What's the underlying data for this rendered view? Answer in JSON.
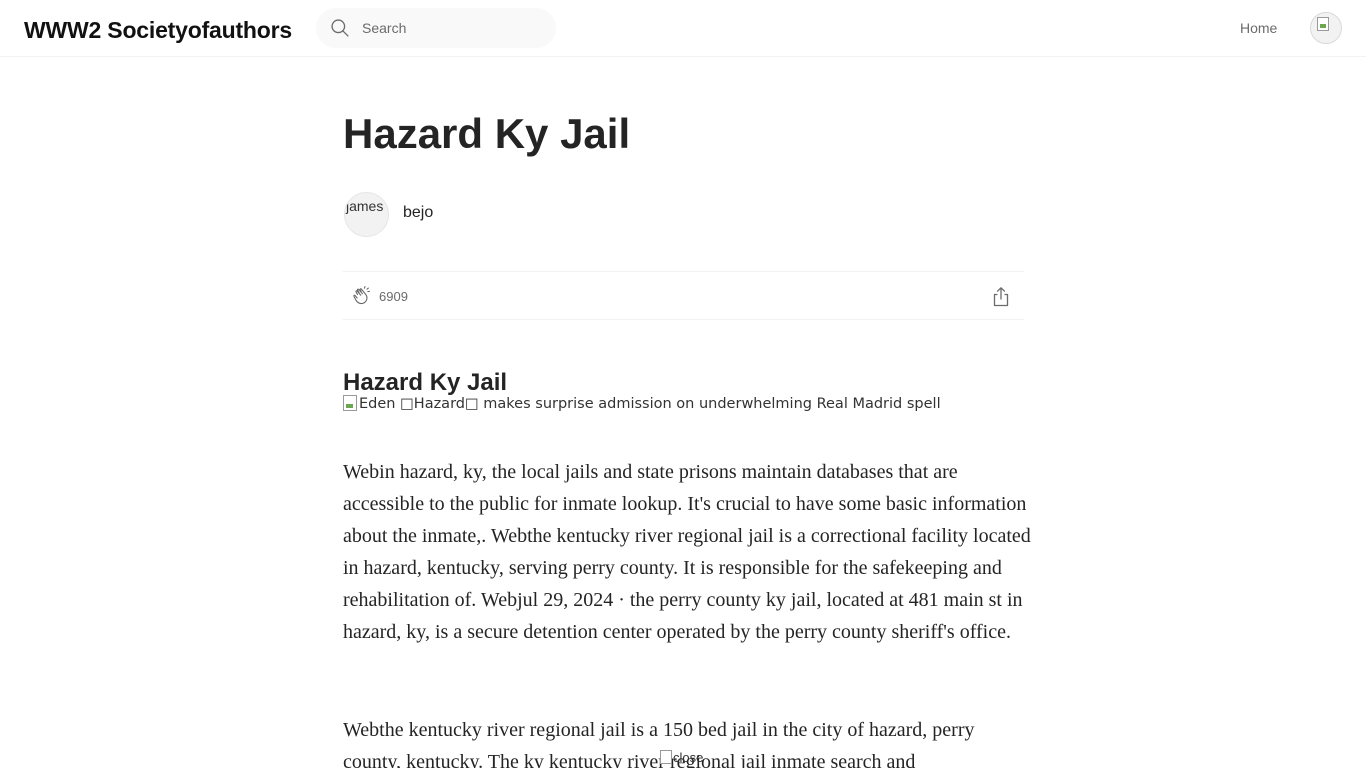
{
  "header": {
    "brand": "WWW2 Societyofauthors",
    "search_placeholder": "Search",
    "nav_home": "Home",
    "avatar_icon": "user-avatar-icon"
  },
  "article": {
    "title": "Hazard Ky Jail",
    "author": {
      "avatar_alt": "james",
      "name": "bejo"
    },
    "claps": "6909",
    "subheading": "Hazard Ky Jail",
    "image_alt": "Eden \u0000Hazard\u0000 makes surprise admission on underwhelming Real Madrid spell",
    "image_alt_display": "Eden □Hazard□ makes surprise admission on underwhelming Real Madrid spell",
    "paragraphs": [
      "Webin hazard, ky, the local jails and state prisons maintain databases that are accessible to the public for inmate lookup. It's crucial to have some basic information about the inmate,. Webthe kentucky river regional jail is a correctional facility located in hazard, kentucky, serving perry county. It is responsible for the safekeeping and rehabilitation of. Webjul 29, 2024 · the perry county ky jail, located at 481 main st in hazard, ky, is a secure detention center operated by the perry county sheriff's office.",
      "Webthe kentucky river regional jail is a 150 bed jail in the city of hazard, perry county, kentucky. The ky kentucky river regional jail inmate search and"
    ]
  },
  "overlay": {
    "close_alt": "close"
  }
}
